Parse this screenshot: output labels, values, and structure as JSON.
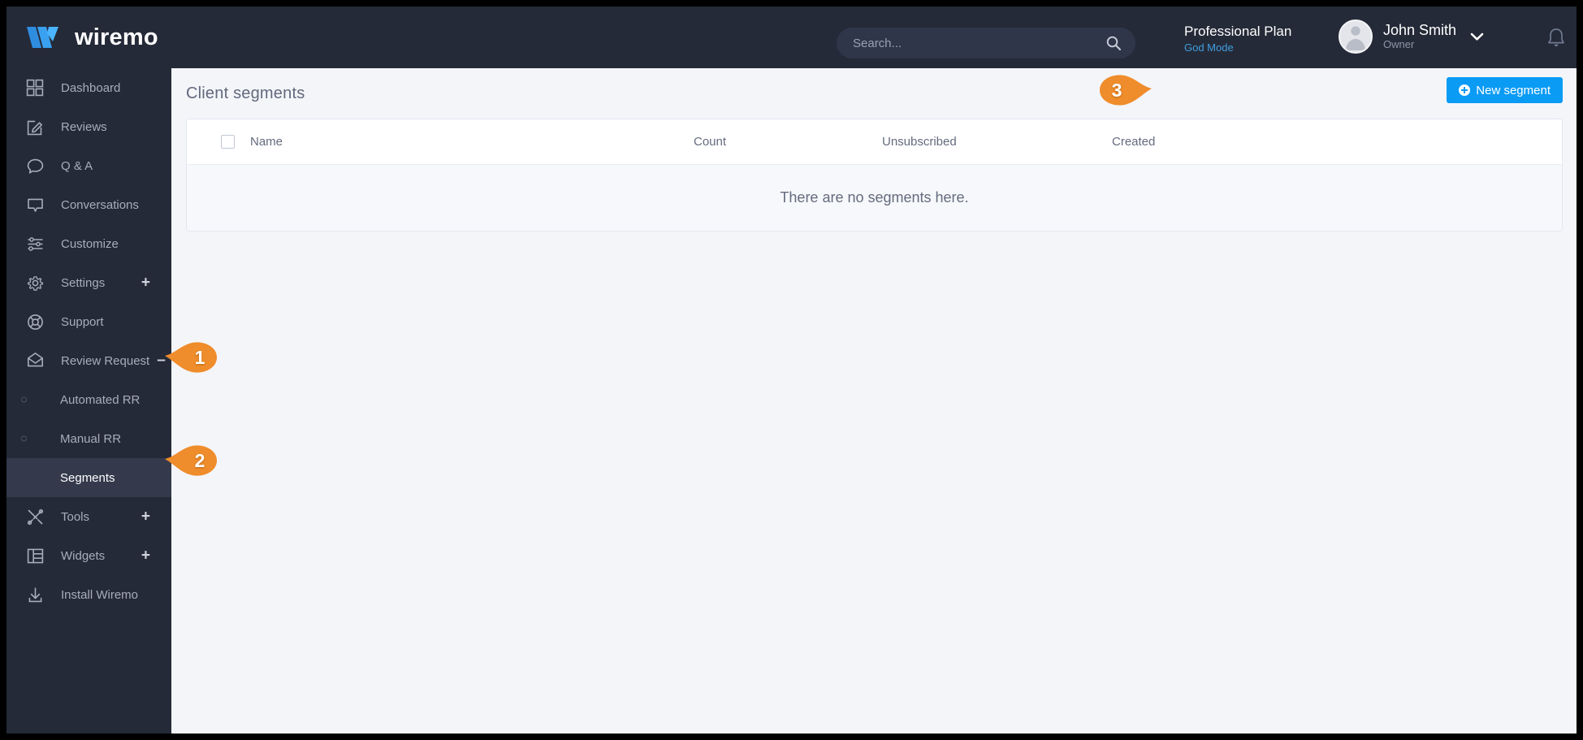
{
  "brand": {
    "name": "wiremo",
    "logo_icon": "wiremo-logo-icon"
  },
  "topbar": {
    "search": {
      "value": "",
      "placeholder": "Search...",
      "icon": "search-icon"
    },
    "plan": {
      "title": "Professional Plan",
      "mode": "God Mode"
    },
    "user": {
      "name": "John Smith",
      "role": "Owner",
      "avatar_icon": "user-avatar-icon",
      "chevron_icon": "chevron-down-icon"
    },
    "notifications": {
      "icon": "bell-icon"
    }
  },
  "sidebar": {
    "items": [
      {
        "label": "Dashboard",
        "icon": "grid-icon",
        "expander": "",
        "active": false
      },
      {
        "label": "Reviews",
        "icon": "edit-square-icon",
        "expander": "",
        "active": false
      },
      {
        "label": "Q & A",
        "icon": "chat-bubble-icon",
        "expander": "",
        "active": false
      },
      {
        "label": "Conversations",
        "icon": "message-icon",
        "expander": "",
        "active": false
      },
      {
        "label": "Customize",
        "icon": "sliders-icon",
        "expander": "",
        "active": false
      },
      {
        "label": "Settings",
        "icon": "gear-icon",
        "expander": "+",
        "active": false
      },
      {
        "label": "Support",
        "icon": "lifebuoy-icon",
        "expander": "",
        "active": false
      },
      {
        "label": "Review Request",
        "icon": "envelope-icon",
        "expander": "–",
        "active": false
      }
    ],
    "sub_items": [
      {
        "label": "Automated RR",
        "active": false
      },
      {
        "label": "Manual RR",
        "active": false
      },
      {
        "label": "Segments",
        "active": true
      }
    ],
    "items_bottom": [
      {
        "label": "Tools",
        "icon": "tools-icon",
        "expander": "+",
        "active": false
      },
      {
        "label": "Widgets",
        "icon": "widgets-icon",
        "expander": "+",
        "active": false
      },
      {
        "label": "Install Wiremo",
        "icon": "download-icon",
        "expander": "",
        "active": false
      }
    ]
  },
  "main": {
    "page_title": "Client segments",
    "new_segment_button": {
      "label": "New segment",
      "icon": "plus-circle-icon"
    },
    "table": {
      "columns": [
        "Name",
        "Count",
        "Unsubscribed",
        "Created"
      ],
      "rows": [],
      "empty_message": "There are no segments here."
    }
  },
  "callouts": [
    {
      "number": "1",
      "direction": "left"
    },
    {
      "number": "2",
      "direction": "left"
    },
    {
      "number": "3",
      "direction": "right"
    }
  ],
  "colors": {
    "sidebar_bg": "#252a38",
    "accent_blue": "#0a9bf5",
    "callout_orange": "#ef8c2b",
    "plan_link": "#3f9fe0",
    "content_bg": "#f4f5f9"
  }
}
